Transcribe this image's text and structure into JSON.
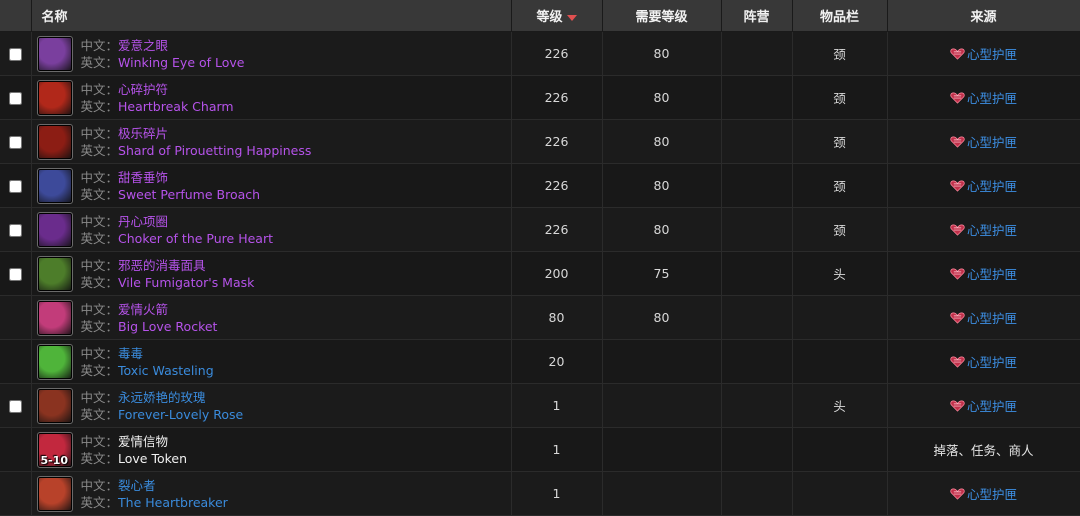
{
  "columns": {
    "name": "名称",
    "level": "等级",
    "req_level": "需要等级",
    "faction": "阵营",
    "slot": "物品栏",
    "source": "来源"
  },
  "name_prefixes": {
    "cn": "中文：",
    "en": "英文："
  },
  "rows": [
    {
      "has_checkbox": true,
      "cn": "爱意之眼",
      "en": "Winking Eye of Love",
      "quality": "epic",
      "icon_color": "#7a3f9e",
      "badge": "",
      "level": "226",
      "req_level": "80",
      "faction": "",
      "slot": "颈",
      "source": "心型护匣",
      "source_link": true
    },
    {
      "has_checkbox": true,
      "cn": "心碎护符",
      "en": "Heartbreak Charm",
      "quality": "epic",
      "icon_color": "#b1281a",
      "badge": "",
      "level": "226",
      "req_level": "80",
      "faction": "",
      "slot": "颈",
      "source": "心型护匣",
      "source_link": true
    },
    {
      "has_checkbox": true,
      "cn": "极乐碎片",
      "en": "Shard of Pirouetting Happiness",
      "quality": "epic",
      "icon_color": "#8c1d14",
      "badge": "",
      "level": "226",
      "req_level": "80",
      "faction": "",
      "slot": "颈",
      "source": "心型护匣",
      "source_link": true
    },
    {
      "has_checkbox": true,
      "cn": "甜香垂饰",
      "en": "Sweet Perfume Broach",
      "quality": "epic",
      "icon_color": "#3d4a9a",
      "badge": "",
      "level": "226",
      "req_level": "80",
      "faction": "",
      "slot": "颈",
      "source": "心型护匣",
      "source_link": true
    },
    {
      "has_checkbox": true,
      "cn": "丹心项圈",
      "en": "Choker of the Pure Heart",
      "quality": "epic",
      "icon_color": "#6a2c8c",
      "badge": "",
      "level": "226",
      "req_level": "80",
      "faction": "",
      "slot": "颈",
      "source": "心型护匣",
      "source_link": true
    },
    {
      "has_checkbox": true,
      "cn": "邪恶的消毒面具",
      "en": "Vile Fumigator's Mask",
      "quality": "epic",
      "icon_color": "#4d7d2a",
      "badge": "",
      "level": "200",
      "req_level": "75",
      "faction": "",
      "slot": "头",
      "source": "心型护匣",
      "source_link": true
    },
    {
      "has_checkbox": false,
      "cn": "爱情火箭",
      "en": "Big Love Rocket",
      "quality": "epic",
      "icon_color": "#c23c7a",
      "badge": "",
      "level": "80",
      "req_level": "80",
      "faction": "",
      "slot": "",
      "source": "心型护匣",
      "source_link": true
    },
    {
      "has_checkbox": false,
      "cn": "毒毒",
      "en": "Toxic Wasteling",
      "quality": "rare",
      "icon_color": "#4fb43a",
      "badge": "",
      "level": "20",
      "req_level": "",
      "faction": "",
      "slot": "",
      "source": "心型护匣",
      "source_link": true
    },
    {
      "has_checkbox": true,
      "cn": "永远娇艳的玫瑰",
      "en": "Forever-Lovely Rose",
      "quality": "rare",
      "icon_color": "#8a3320",
      "badge": "",
      "level": "1",
      "req_level": "",
      "faction": "",
      "slot": "头",
      "source": "心型护匣",
      "source_link": true
    },
    {
      "has_checkbox": false,
      "cn": "爱情信物",
      "en": "Love Token",
      "quality": "common",
      "icon_color": "#c2283e",
      "badge": "5-10",
      "level": "1",
      "req_level": "",
      "faction": "",
      "slot": "",
      "source": "掉落、任务、商人",
      "source_link": false
    },
    {
      "has_checkbox": false,
      "cn": "裂心者",
      "en": "The Heartbreaker",
      "quality": "rare",
      "icon_color": "#b8422a",
      "badge": "",
      "level": "1",
      "req_level": "",
      "faction": "",
      "slot": "",
      "source": "心型护匣",
      "source_link": true
    }
  ]
}
